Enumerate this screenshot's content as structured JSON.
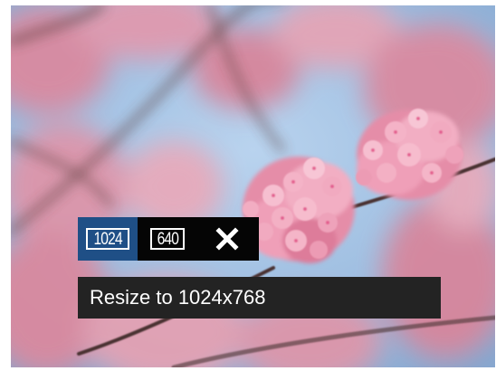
{
  "toolbar": {
    "options": [
      {
        "label": "1024",
        "selected": true
      },
      {
        "label": "640",
        "selected": false
      }
    ],
    "close_icon": "close-icon",
    "selected_color": "#1f4f86"
  },
  "status": {
    "text": "Resize to 1024x768"
  }
}
